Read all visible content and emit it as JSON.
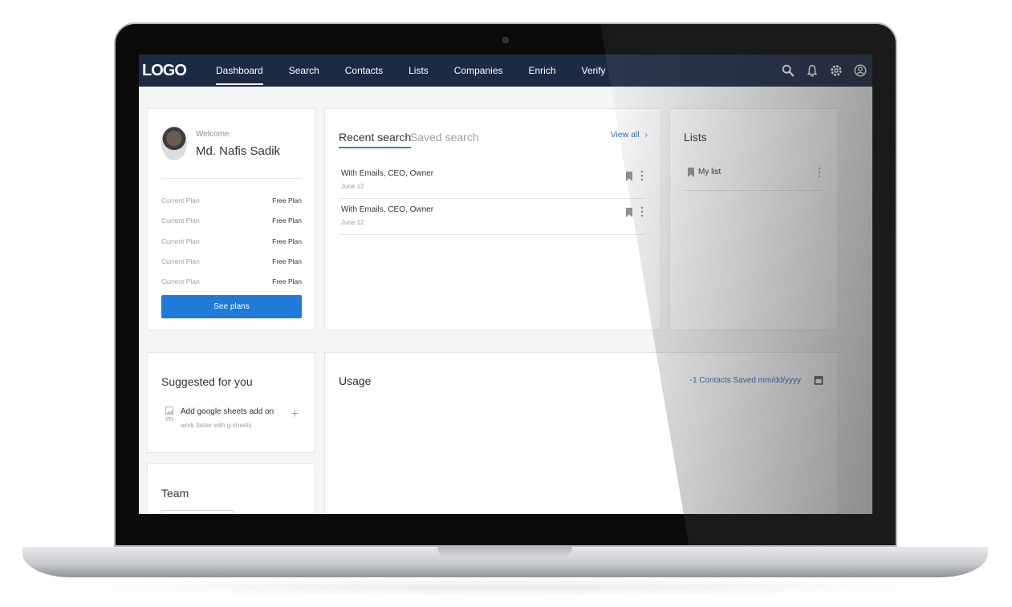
{
  "nav": {
    "logo": "LOGO",
    "items": [
      "Dashboard",
      "Search",
      "Contacts",
      "Lists",
      "Companies",
      "Enrich",
      "Verify"
    ],
    "active": "Dashboard"
  },
  "profile": {
    "welcome": "Welcome",
    "name": "Md. Nafis Sadik",
    "plans": [
      {
        "label": "Current Plan",
        "value": "Free Plan"
      },
      {
        "label": "Current Plan",
        "value": "Free Plan"
      },
      {
        "label": "Current Plan",
        "value": "Free Plan"
      },
      {
        "label": "Current Plan",
        "value": "Free Plan"
      },
      {
        "label": "Current Plan",
        "value": "Free Plan"
      }
    ],
    "button": "See plans"
  },
  "searches": {
    "tab_recent": "Recent search",
    "tab_saved": "Saved search",
    "view_all": "View all",
    "items": [
      {
        "title": "With Emails, CEO, Owner",
        "date": "June 12"
      },
      {
        "title": "With Emails, CEO, Owner",
        "date": "June 12"
      }
    ]
  },
  "lists": {
    "title": "Lists",
    "items": [
      {
        "label": "My list"
      }
    ]
  },
  "suggested": {
    "title": "Suggested for you",
    "item_title": "Add google sheets add on",
    "item_sub": "work faster with g-sheets",
    "img_alt": "im"
  },
  "team": {
    "title": "Team"
  },
  "usage": {
    "title": "Usage",
    "meta": "-1 Contacts Saved mm/dd/yyyy"
  },
  "colors": {
    "nav_bg": "#1c2a44",
    "primary_button": "#1f7ad9",
    "link": "#1f6fc2",
    "tab_underline": "#2a8fa0"
  }
}
